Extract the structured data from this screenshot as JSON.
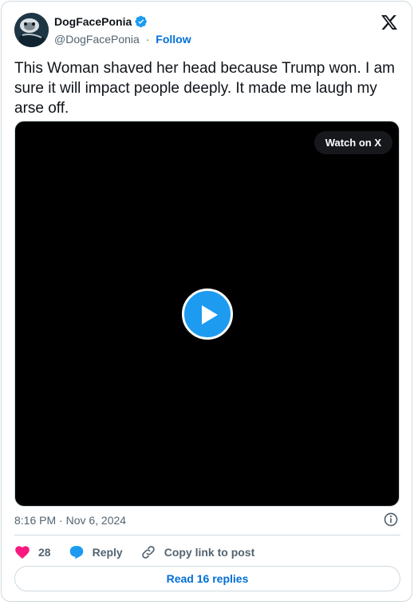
{
  "author": {
    "display_name": "DogFacePonia",
    "handle": "@DogFacePonia",
    "separator": "·",
    "follow_label": "Follow",
    "avatar_icon": "avatar-bulldog",
    "verified_color": "#1d9bf0"
  },
  "tweet": {
    "text": "This Woman shaved her head because Trump won. I am sure it will impact people deeply. It made me laugh my arse off."
  },
  "media": {
    "watch_label": "Watch on X",
    "play_icon": "play-icon",
    "accent": "#1d9bf0"
  },
  "meta": {
    "timestamp": "8:16 PM · Nov 6, 2024"
  },
  "actions": {
    "like_count": "28",
    "reply_label": "Reply",
    "copy_label": "Copy link to post"
  },
  "footer": {
    "replies_label": "Read 16 replies"
  },
  "colors": {
    "like": "#f91880",
    "reply": "#1d9bf0",
    "link": "#006fd6",
    "muted": "#536471"
  }
}
